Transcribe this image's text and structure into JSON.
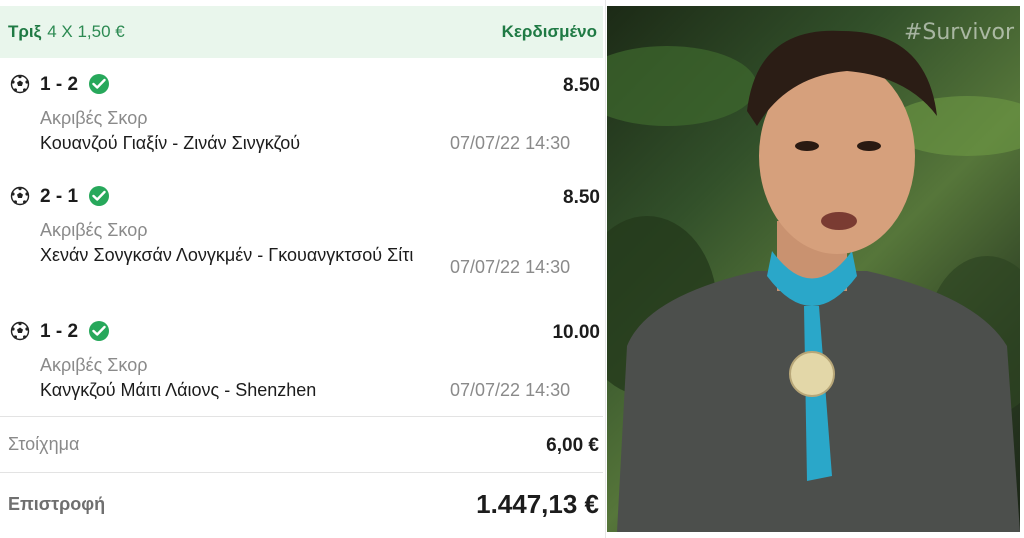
{
  "bet": {
    "type_label": "Τριξ",
    "combo": "4 X 1,50 €",
    "status": "Κερδισμένο"
  },
  "selections": [
    {
      "score": "1 - 2",
      "odds": "8.50",
      "market": "Ακριβές Σκορ",
      "match": "Κουανζού Γιαξίν - Ζινάν Σινγκζού",
      "datetime": "07/07/22 14:30"
    },
    {
      "score": "2 - 1",
      "odds": "8.50",
      "market": "Ακριβές Σκορ",
      "match": "Χενάν Σονγκσάν Λονγκμέν - Γκουανγκτσού Σίτι",
      "datetime": "07/07/22 14:30"
    },
    {
      "score": "1 - 2",
      "odds": "10.00",
      "market": "Ακριβές Σκορ",
      "match": "Κανγκζού Μάιτι Λάιονς - Shenzhen",
      "datetime": "07/07/22 14:30"
    }
  ],
  "stake": {
    "label": "Στοίχημα",
    "value": "6,00 €"
  },
  "returns": {
    "label": "Επιστροφή",
    "value": "1.447,13 €"
  },
  "photo": {
    "watermark": "#Survivor"
  },
  "colors": {
    "accent": "#27a85b",
    "header_bg": "#e9f6ec",
    "scarf": "#2aa7c9"
  },
  "icons": {
    "sport": "soccer-ball-icon",
    "won": "check-circle-icon"
  }
}
